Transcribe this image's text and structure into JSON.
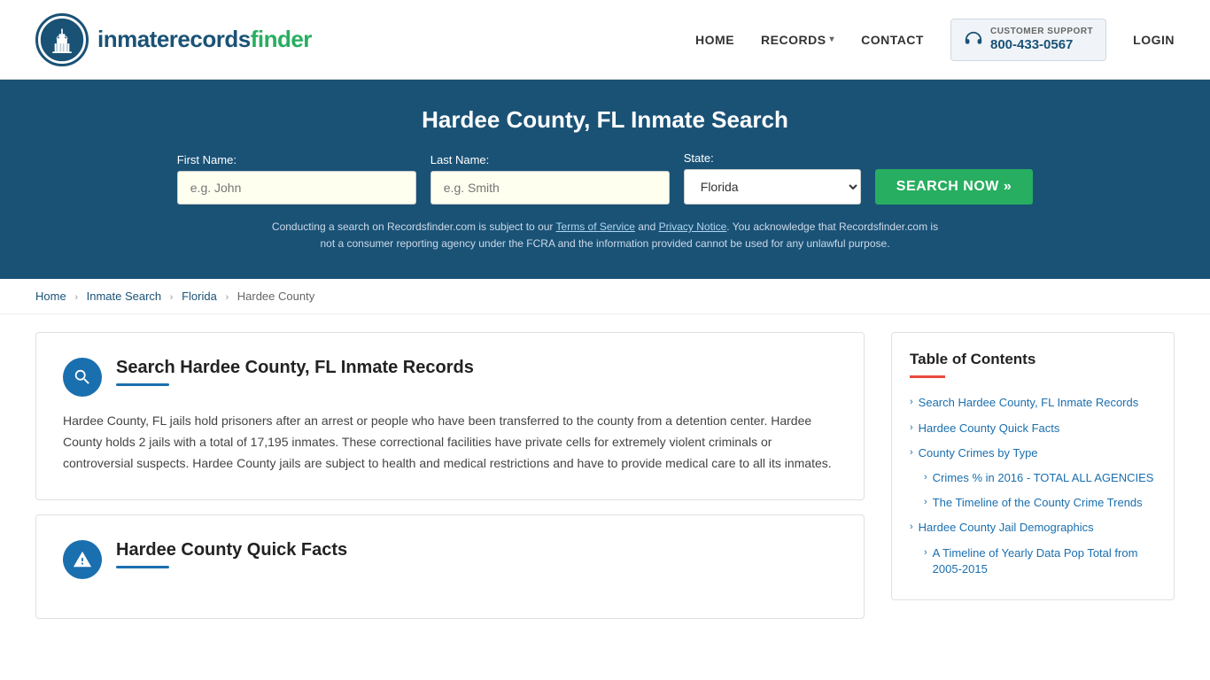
{
  "header": {
    "logo_text_part1": "inmaterecords",
    "logo_text_part2": "finder",
    "nav": {
      "home": "HOME",
      "records": "RECORDS",
      "contact": "CONTACT",
      "login": "LOGIN"
    },
    "support": {
      "label": "CUSTOMER SUPPORT",
      "number": "800-433-0567"
    }
  },
  "hero": {
    "title": "Hardee County, FL Inmate Search",
    "form": {
      "first_name_label": "First Name:",
      "first_name_placeholder": "e.g. John",
      "last_name_label": "Last Name:",
      "last_name_placeholder": "e.g. Smith",
      "state_label": "State:",
      "state_value": "Florida",
      "search_button": "SEARCH NOW »"
    },
    "disclaimer": "Conducting a search on Recordsfinder.com is subject to our Terms of Service and Privacy Notice. You acknowledge that Recordsfinder.com is not a consumer reporting agency under the FCRA and the information provided cannot be used for any unlawful purpose."
  },
  "breadcrumb": {
    "home": "Home",
    "inmate_search": "Inmate Search",
    "florida": "Florida",
    "hardee_county": "Hardee County"
  },
  "main_section": {
    "title": "Search Hardee County, FL Inmate Records",
    "body": "Hardee County, FL jails hold prisoners after an arrest or people who have been transferred to the county from a detention center. Hardee County holds 2 jails with a total of 17,195 inmates. These correctional facilities have private cells for extremely violent criminals or controversial suspects. Hardee County jails are subject to health and medical restrictions and have to provide medical care to all its inmates."
  },
  "quick_facts_section": {
    "title": "Hardee County Quick Facts"
  },
  "toc": {
    "title": "Table of Contents",
    "items": [
      {
        "label": "Search Hardee County, FL Inmate Records",
        "sub": false
      },
      {
        "label": "Hardee County Quick Facts",
        "sub": false
      },
      {
        "label": "County Crimes by Type",
        "sub": false
      },
      {
        "label": "Crimes % in 2016 - TOTAL ALL AGENCIES",
        "sub": true
      },
      {
        "label": "The Timeline of the County Crime Trends",
        "sub": true
      },
      {
        "label": "Hardee County Jail Demographics",
        "sub": false
      },
      {
        "label": "A Timeline of Yearly Data Pop Total from 2005-2015",
        "sub": true
      }
    ]
  }
}
